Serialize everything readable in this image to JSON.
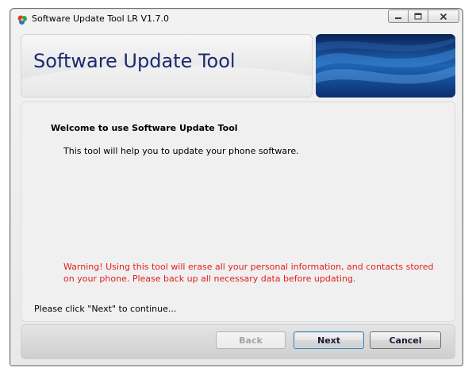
{
  "window": {
    "title": "Software Update Tool LR V1.7.0",
    "controls": [
      "minimize-icon",
      "maximize-icon",
      "close-icon"
    ]
  },
  "header": {
    "app_title": "Software Update Tool",
    "banner_colors": [
      "#0b2f6e",
      "#1e64b4",
      "#0a2356"
    ]
  },
  "content": {
    "welcome": "Welcome to use Software Update Tool",
    "intro": "This tool will help you to update your phone software.",
    "warning": "Warning! Using this tool will erase all your personal information, and contacts stored on your phone. Please back up all necessary data before updating.",
    "continue": "Please click \"Next\" to continue..."
  },
  "footer": {
    "back_label": "Back",
    "back_enabled": false,
    "next_label": "Next",
    "cancel_label": "Cancel"
  },
  "colors": {
    "title": "#1c2a6e",
    "warning": "#e0201e"
  }
}
